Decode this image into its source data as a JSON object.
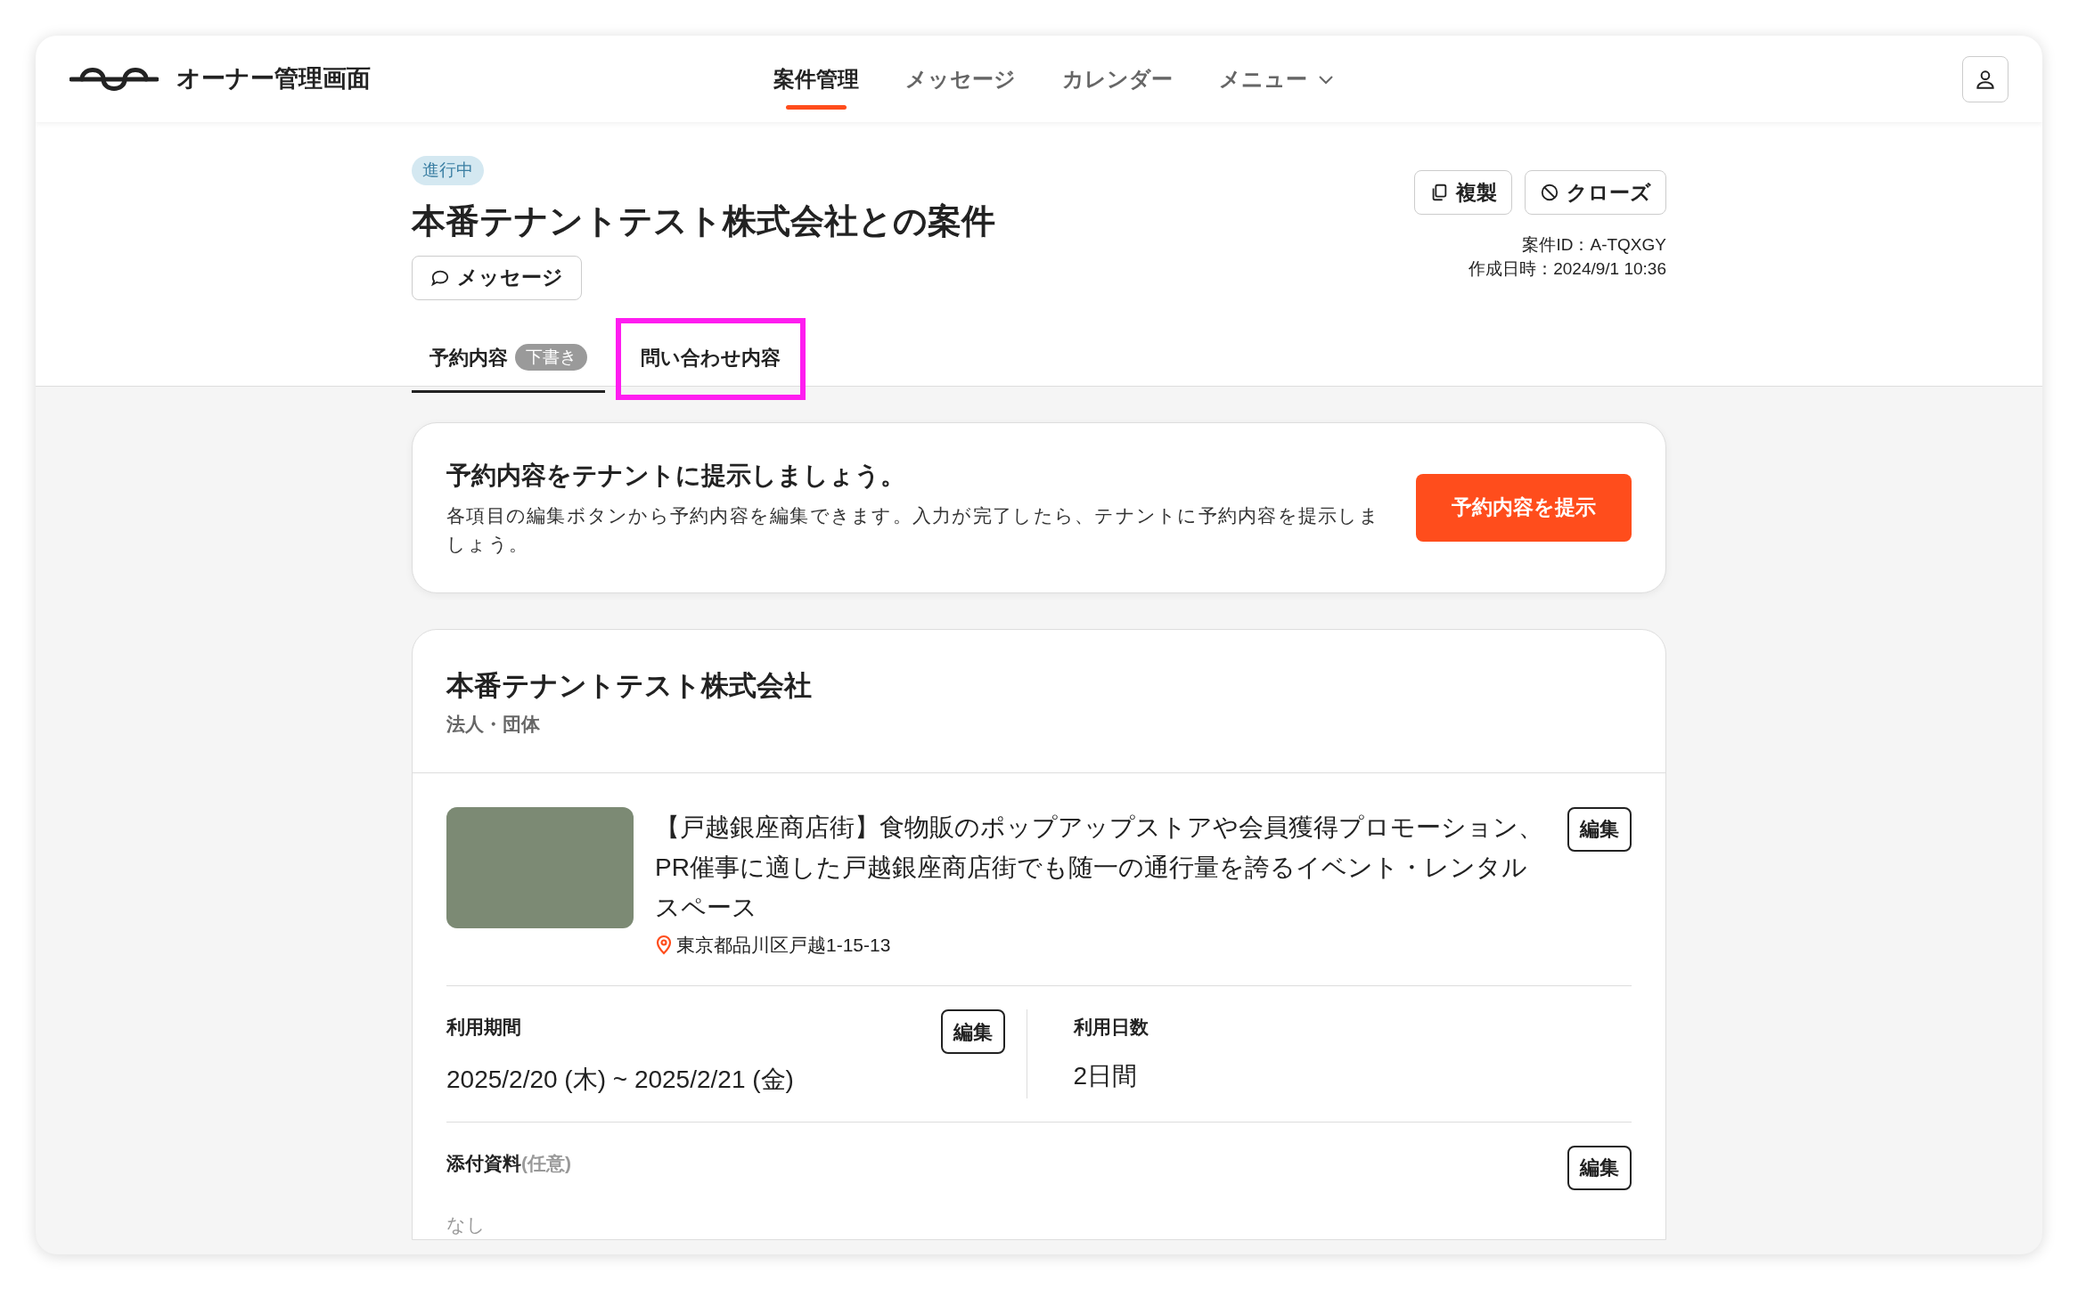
{
  "header": {
    "logo_text": "オーナー管理画面",
    "nav": [
      {
        "label": "案件管理",
        "selected": true
      },
      {
        "label": "メッセージ",
        "selected": false
      },
      {
        "label": "カレンダー",
        "selected": false
      },
      {
        "label": "メニュー",
        "selected": false,
        "dropdown": true
      }
    ]
  },
  "case": {
    "status": "進行中",
    "title": "本番テナントテスト株式会社との案件",
    "message_button": "メッセージ",
    "actions": [
      {
        "kind": "copy",
        "label": "複製"
      },
      {
        "kind": "close",
        "label": "クローズ"
      }
    ],
    "case_id": "案件ID：A-TQXGY",
    "created": "作成日時：2024/9/1 10:36"
  },
  "tabs": [
    {
      "label": "予約内容",
      "badge": "下書き",
      "selected": true,
      "annotated": false
    },
    {
      "label": "問い合わせ内容",
      "selected": false,
      "annotated": true
    }
  ],
  "notice": {
    "heading": "予約内容をテナントに提示しましょう。",
    "body": "各項目の編集ボタンから予約内容を編集できます。入力が完了したら、テナントに予約内容を提示しましょう。",
    "button": "予約内容を提示"
  },
  "tenant": {
    "name": "本番テナントテスト株式会社",
    "type": "法人・団体"
  },
  "listing": {
    "title": "【戸越銀座商店街】食物販のポップアップストアや会員獲得プロモーション、PR催事に適した戸越銀座商店街でも随一の通行量を誇るイベント・レンタルスペース",
    "address": "東京都品川区戸越1-15-13",
    "edit": "編集"
  },
  "period": {
    "label": "利用期間",
    "value": "2025/2/20 (木) ~ 2025/2/21 (金)",
    "edit": "編集"
  },
  "days": {
    "label": "利用日数",
    "value": "2日間"
  },
  "attachments": {
    "label": "添付資料",
    "optional": "(任意)",
    "value": "なし",
    "edit": "編集"
  }
}
